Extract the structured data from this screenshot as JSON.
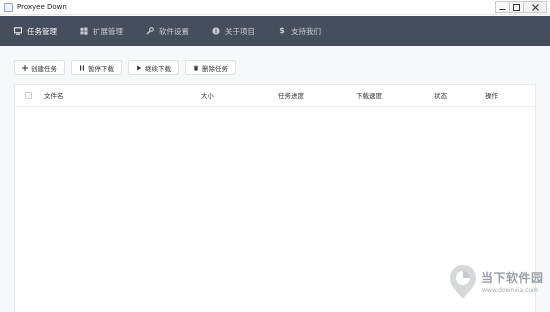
{
  "window": {
    "title": "Proxyee Down",
    "icon": "app-window-icon",
    "controls": [
      "minimize-icon",
      "maximize-icon",
      "close-icon"
    ]
  },
  "nav": {
    "items": [
      {
        "label": "任务管理",
        "icon": "monitor-icon",
        "active": true
      },
      {
        "label": "扩展管理",
        "icon": "windows-icon",
        "active": false
      },
      {
        "label": "软件设置",
        "icon": "wrench-icon",
        "active": false
      },
      {
        "label": "关于项目",
        "icon": "info-icon",
        "active": false
      },
      {
        "label": "支持我们",
        "icon": "dollar-icon",
        "active": false
      }
    ]
  },
  "toolbar": {
    "create_label": "创建任务",
    "pause_label": "暂停下载",
    "resume_label": "继续下载",
    "delete_label": "删除任务"
  },
  "table": {
    "columns": [
      "文件名",
      "大小",
      "任务进度",
      "下载速度",
      "状态",
      "操作"
    ],
    "rows": []
  },
  "watermark": {
    "name": "当下软件园",
    "url": "www.downxia.com"
  },
  "colors": {
    "navbar": "#464e5d",
    "content_bg": "#f7f8fa",
    "nav_text": "#c8cdd6",
    "nav_active": "#ffffff"
  }
}
